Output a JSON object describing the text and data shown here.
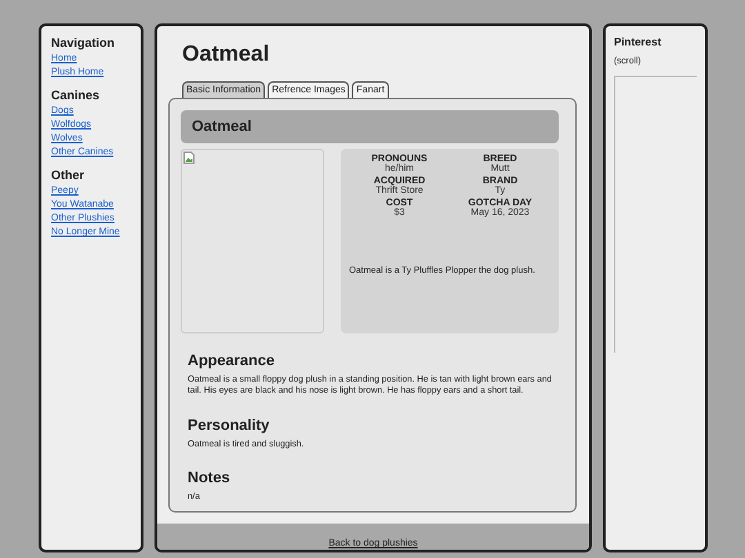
{
  "sidebar": {
    "sections": [
      {
        "heading": "Navigation",
        "links": [
          "Home",
          "Plush Home"
        ]
      },
      {
        "heading": "Canines",
        "links": [
          "Dogs",
          "Wolfdogs",
          "Wolves",
          "Other Canines"
        ]
      },
      {
        "heading": "Other",
        "links": [
          "Peepy",
          "You Watanabe",
          "Other Plushies",
          "No Longer Mine"
        ]
      }
    ]
  },
  "main": {
    "title": "Oatmeal",
    "tabs": [
      {
        "label": "Basic Information",
        "selected": true
      },
      {
        "label": "Refrence Images",
        "selected": false
      },
      {
        "label": "Fanart",
        "selected": false
      }
    ],
    "card_title": "Oatmeal",
    "image": {
      "kind": "broken"
    },
    "facts": [
      {
        "label": "PRONOUNS",
        "value": "he/him"
      },
      {
        "label": "BREED",
        "value": "Mutt"
      },
      {
        "label": "ACQUIRED",
        "value": "Thrift Store"
      },
      {
        "label": "BRAND",
        "value": "Ty"
      },
      {
        "label": "COST",
        "value": "$3"
      },
      {
        "label": "GOTCHA DAY",
        "value": "May 16, 2023"
      }
    ],
    "summary": "Oatmeal is a Ty Pluffles Plopper the dog plush.",
    "sections": [
      {
        "heading": "Appearance",
        "text": "Oatmeal is a small floppy dog plush in a standing position. He is tan with light brown ears and tail. His eyes are black and his nose is light brown. He has floppy ears and a short tail."
      },
      {
        "heading": "Personality",
        "text": "Oatmeal is tired and sluggish."
      },
      {
        "heading": "Notes",
        "text": "n/a"
      }
    ],
    "footer_link": "Back to dog plushies"
  },
  "right_panel": {
    "title": "Pinterest",
    "note": "(scroll)"
  }
}
